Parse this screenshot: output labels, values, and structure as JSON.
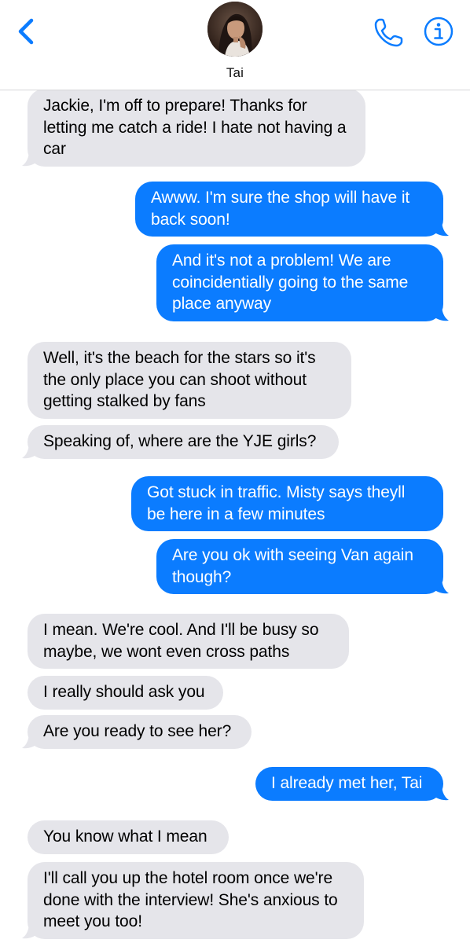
{
  "header": {
    "contact_name": "Tai",
    "back_icon": "chevron-left-icon",
    "call_icon": "phone-icon",
    "info_icon": "info-icon",
    "accent_color": "#0b7cff"
  },
  "colors": {
    "incoming_bubble": "#e5e5ea",
    "outgoing_bubble": "#0b7cff"
  },
  "messages": [
    {
      "direction": "incoming",
      "text": "Jackie, I'm off to prepare! Thanks for letting me catch a ride! I hate not having a car"
    },
    {
      "direction": "outgoing",
      "text": "Awww. I'm sure the shop will have it back soon!"
    },
    {
      "direction": "outgoing",
      "text": "And it's not a problem! We are coincidentially going to the same place anyway"
    },
    {
      "direction": "incoming",
      "text": "Well, it's the beach for the stars so it's the only place you can shoot without getting stalked by fans"
    },
    {
      "direction": "incoming",
      "text": "Speaking of, where are the YJE girls?"
    },
    {
      "direction": "outgoing",
      "text": "Got stuck in traffic. Misty says theyll be here in a few minutes"
    },
    {
      "direction": "outgoing",
      "text": "Are you ok with seeing Van again though?"
    },
    {
      "direction": "incoming",
      "text": "I mean. We're cool. And I'll be busy so maybe, we wont even cross paths"
    },
    {
      "direction": "incoming",
      "text": "I really should ask you"
    },
    {
      "direction": "incoming",
      "text": "Are you ready to see her?"
    },
    {
      "direction": "outgoing",
      "text": "I already met her, Tai"
    },
    {
      "direction": "incoming",
      "text": "You know what I mean"
    },
    {
      "direction": "incoming",
      "text": "I'll call you up the hotel room once we're done with the interview! She's anxious to meet you too!"
    }
  ]
}
